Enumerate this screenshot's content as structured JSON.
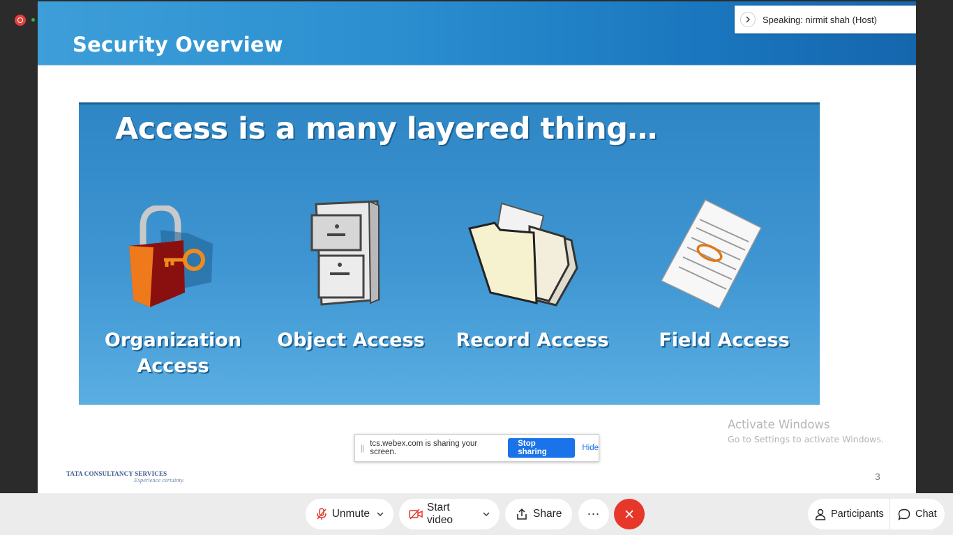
{
  "window": {
    "recording_indicator": "record-icon",
    "status_indicator": "green-dot"
  },
  "slide": {
    "title": "Security Overview",
    "banner": {
      "heading": "Access is a many layered thing…",
      "items": [
        {
          "label_line1": "Organization",
          "label_line2": "Access",
          "icon": "padlock-key-icon"
        },
        {
          "label_line1": "Object Access",
          "label_line2": "",
          "icon": "filing-cabinet-icon"
        },
        {
          "label_line1": "Record Access",
          "label_line2": "",
          "icon": "folder-records-icon"
        },
        {
          "label_line1": "Field Access",
          "label_line2": "",
          "icon": "document-field-icon"
        }
      ]
    },
    "footer": {
      "company": "TATA CONSULTANCY SERVICES",
      "tagline": "Experience certainty.",
      "page_number": "3"
    }
  },
  "share_notice": {
    "message": "tcs.webex.com is sharing your screen.",
    "stop_label": "Stop sharing",
    "hide_label": "Hide"
  },
  "watermark": {
    "line1": "Activate Windows",
    "line2": "Go to Settings to activate Windows."
  },
  "speaking": {
    "text": "Speaking: nirmit shah (Host)"
  },
  "toolbar": {
    "unmute_label": "Unmute",
    "video_label": "Start video",
    "share_label": "Share",
    "more_label": "⋯",
    "participants_label": "Participants",
    "chat_label": "Chat",
    "colors": {
      "end_call": "#e7372b",
      "muted_icon": "#e7372b",
      "accent": "#1a73e8"
    }
  }
}
